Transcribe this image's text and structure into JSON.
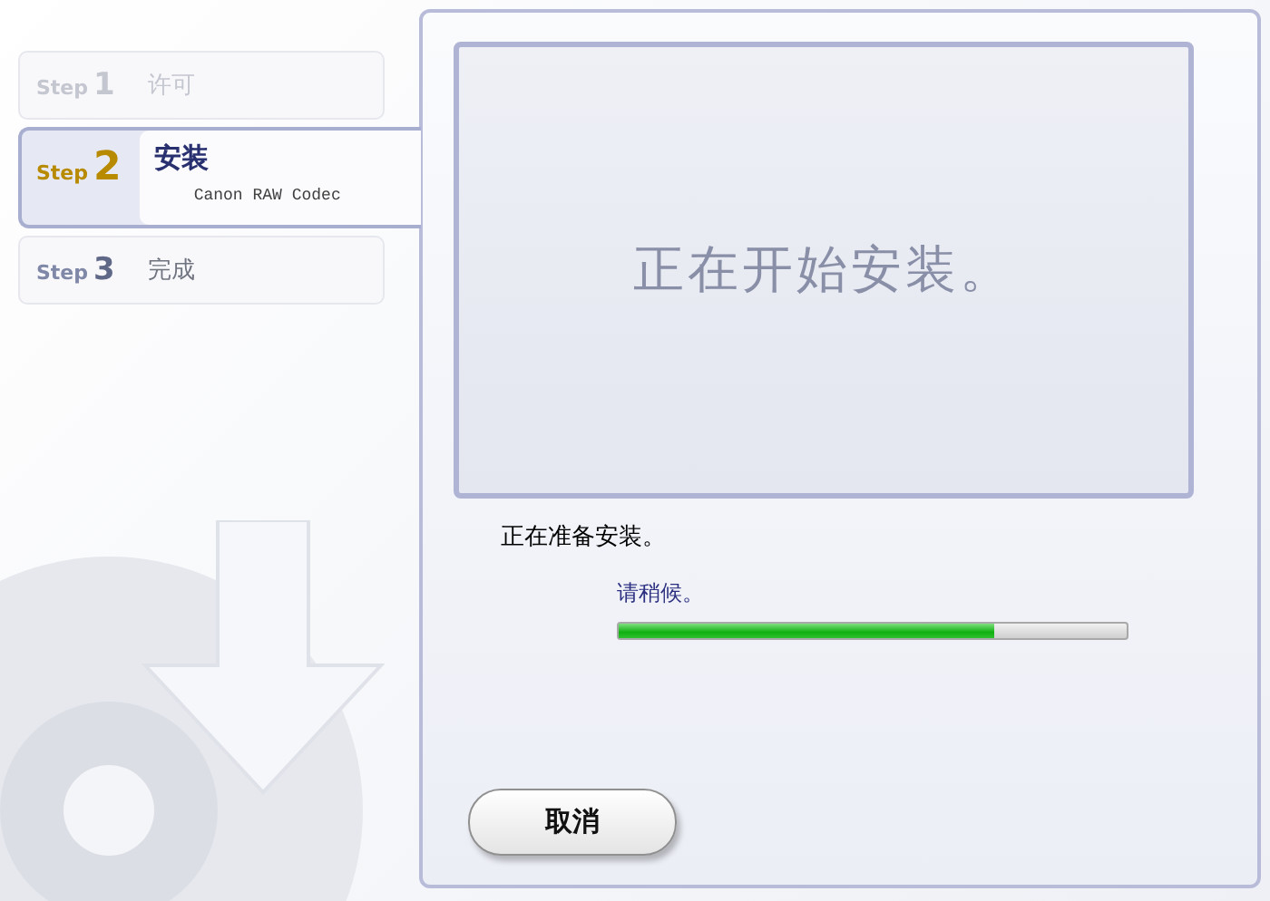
{
  "steps": [
    {
      "step_word": "Step",
      "number": "1",
      "label": "许可",
      "kind": "done",
      "selected": false
    },
    {
      "step_word": "Step",
      "number": "2",
      "label": "安装",
      "sublabel": "Canon RAW Codec",
      "kind": "current",
      "selected": true
    },
    {
      "step_word": "Step",
      "number": "3",
      "label": "完成",
      "kind": "pending",
      "selected": false
    }
  ],
  "banner": "正在开始安装。",
  "status": "正在准备安装。",
  "progress": {
    "label": "请稍候。",
    "level": 0.74
  },
  "buttons": [
    {
      "label": "取消"
    }
  ]
}
